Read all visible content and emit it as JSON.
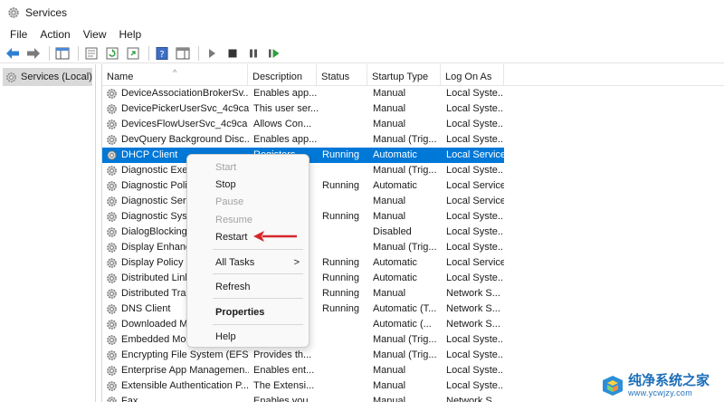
{
  "window": {
    "title": "Services"
  },
  "menu": [
    "File",
    "Action",
    "View",
    "Help"
  ],
  "toolbar": {
    "icons": [
      "back-arrow-icon",
      "forward-arrow-icon",
      "show-hide-console-tree-icon",
      "properties-icon",
      "refresh-icon",
      "export-list-icon",
      "help-icon",
      "show-hide-action-pane-icon",
      "play-icon",
      "stop-icon",
      "pause-icon",
      "resume-icon"
    ]
  },
  "tree": {
    "root_label": "Services (Local)"
  },
  "columns": {
    "name": "Name",
    "description": "Description",
    "status": "Status",
    "startup": "Startup Type",
    "logon": "Log On As",
    "sort_indicator": "^"
  },
  "services": [
    {
      "name": "DeviceAssociationBrokerSv...",
      "description": "Enables app...",
      "status": "",
      "startup": "Manual",
      "logon": "Local Syste..."
    },
    {
      "name": "DevicePickerUserSvc_4c9ca",
      "description": "This user ser...",
      "status": "",
      "startup": "Manual",
      "logon": "Local Syste..."
    },
    {
      "name": "DevicesFlowUserSvc_4c9ca",
      "description": "Allows Con...",
      "status": "",
      "startup": "Manual",
      "logon": "Local Syste..."
    },
    {
      "name": "DevQuery Background Disc...",
      "description": "Enables app...",
      "status": "",
      "startup": "Manual (Trig...",
      "logon": "Local Syste..."
    },
    {
      "name": "DHCP Client",
      "description": "Registers...",
      "status": "Running",
      "startup": "Automatic",
      "logon": "Local Service",
      "selected": true
    },
    {
      "name": "Diagnostic Exec...",
      "description": "",
      "status": "",
      "startup": "Manual (Trig...",
      "logon": "Local Syste..."
    },
    {
      "name": "Diagnostic Poli...",
      "description": "",
      "status": "Running",
      "startup": "Automatic",
      "logon": "Local Service"
    },
    {
      "name": "Diagnostic Servi...",
      "description": "",
      "status": "",
      "startup": "Manual",
      "logon": "Local Service"
    },
    {
      "name": "Diagnostic Syst...",
      "description": "",
      "status": "Running",
      "startup": "Manual",
      "logon": "Local Syste..."
    },
    {
      "name": "DialogBlocking...",
      "description": "",
      "status": "",
      "startup": "Disabled",
      "logon": "Local Syste..."
    },
    {
      "name": "Display Enhanc...",
      "description": "",
      "status": "",
      "startup": "Manual (Trig...",
      "logon": "Local Syste..."
    },
    {
      "name": "Display Policy S...",
      "description": "",
      "status": "Running",
      "startup": "Automatic",
      "logon": "Local Service"
    },
    {
      "name": "Distributed Link...",
      "description": "",
      "status": "Running",
      "startup": "Automatic",
      "logon": "Local Syste..."
    },
    {
      "name": "Distributed Tran...",
      "description": "",
      "status": "Running",
      "startup": "Manual",
      "logon": "Network S..."
    },
    {
      "name": "DNS Client",
      "description": "",
      "status": "Running",
      "startup": "Automatic (T...",
      "logon": "Network S..."
    },
    {
      "name": "Downloaded M...",
      "description": "",
      "status": "",
      "startup": "Automatic (...",
      "logon": "Network S..."
    },
    {
      "name": "Embedded Mod...",
      "description": "",
      "status": "",
      "startup": "Manual (Trig...",
      "logon": "Local Syste..."
    },
    {
      "name": "Encrypting File System (EFS)",
      "description": "Provides th...",
      "status": "",
      "startup": "Manual (Trig...",
      "logon": "Local Syste..."
    },
    {
      "name": "Enterprise App Managemen...",
      "description": "Enables ent...",
      "status": "",
      "startup": "Manual",
      "logon": "Local Syste..."
    },
    {
      "name": "Extensible Authentication P...",
      "description": "The Extensi...",
      "status": "",
      "startup": "Manual",
      "logon": "Local Syste..."
    },
    {
      "name": "Fax",
      "description": "Enables you...",
      "status": "",
      "startup": "Manual",
      "logon": "Network S..."
    }
  ],
  "context_menu": {
    "start": "Start",
    "stop": "Stop",
    "pause": "Pause",
    "resume": "Resume",
    "restart": "Restart",
    "all_tasks": "All Tasks",
    "all_tasks_chevron": ">",
    "refresh": "Refresh",
    "properties": "Properties",
    "help": "Help"
  },
  "annotation": {
    "arrow_color": "#d7262b"
  },
  "watermark": {
    "line1": "纯净系统之家",
    "line2": "www.ycwjzy.com"
  },
  "colors": {
    "selection": "#0078d7",
    "accent": "#0078d7"
  }
}
